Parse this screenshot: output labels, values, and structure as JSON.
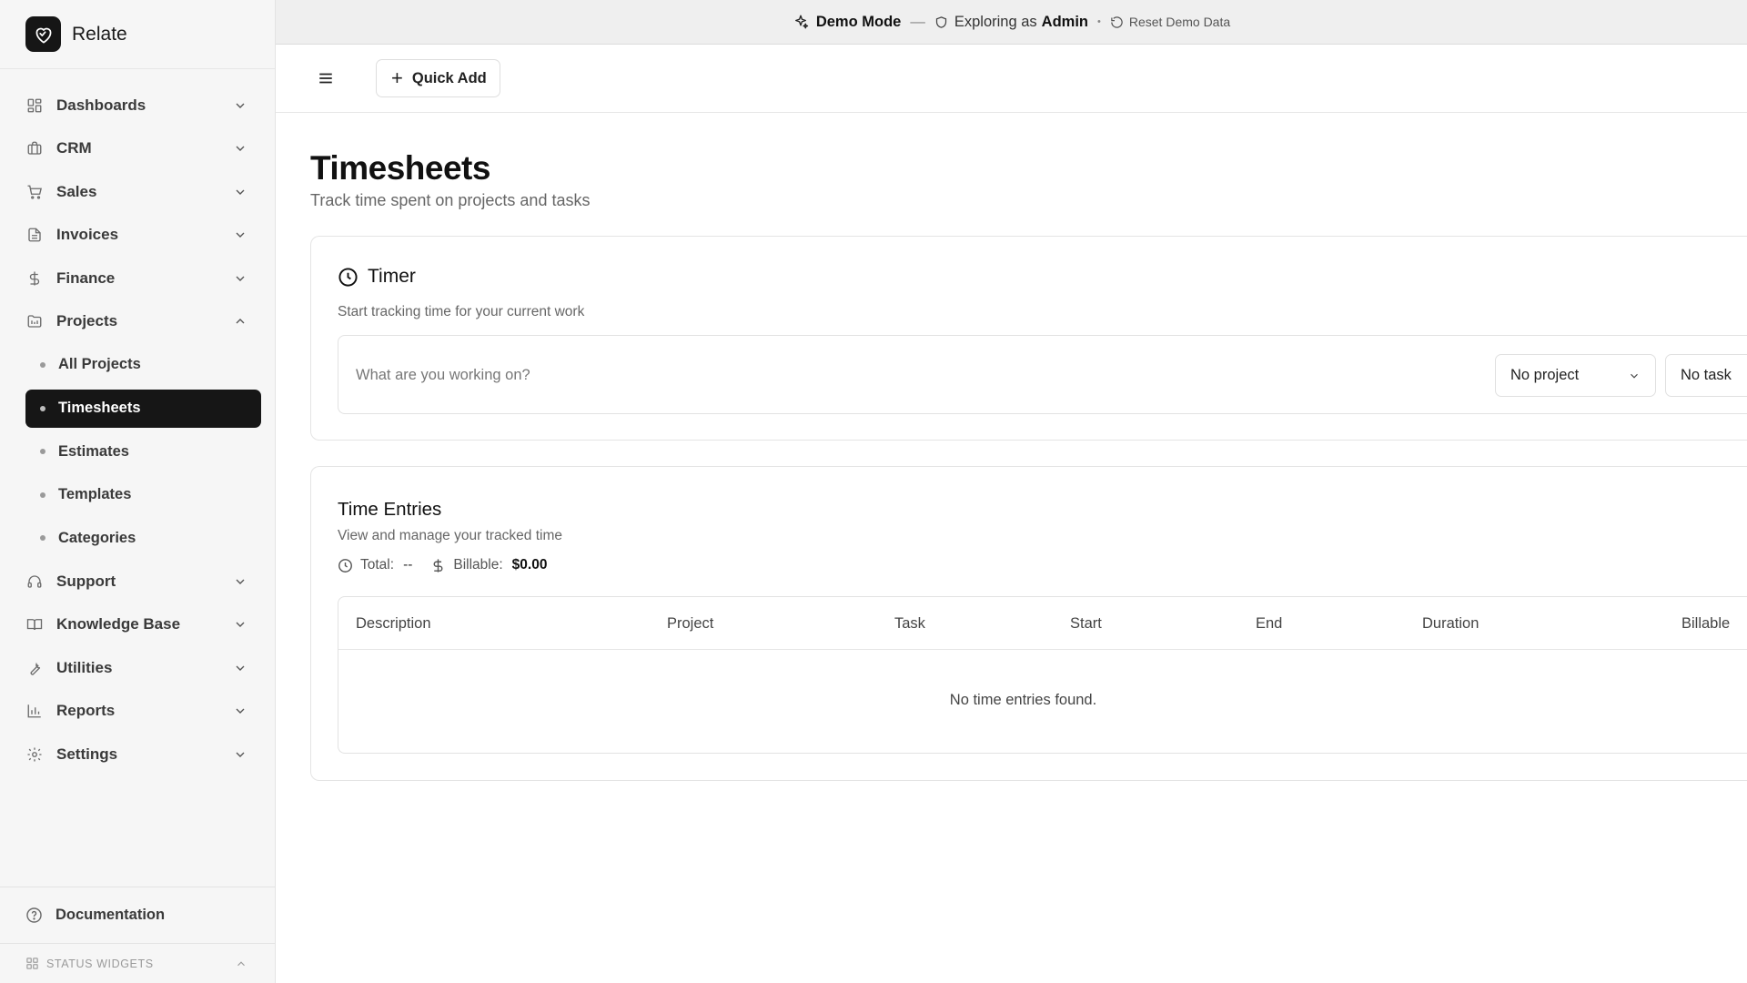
{
  "brand": {
    "name": "Relate"
  },
  "demo_bar": {
    "mode_label": "Demo Mode",
    "dash": "—",
    "exploring_prefix": "Exploring as",
    "role": "Admin",
    "dot": "•",
    "reset_label": "Reset Demo Data"
  },
  "toolbar": {
    "quick_add_label": "Quick Add"
  },
  "sidebar": {
    "items": [
      {
        "label": "Dashboards",
        "icon": "dashboard-icon"
      },
      {
        "label": "CRM",
        "icon": "briefcase-icon"
      },
      {
        "label": "Sales",
        "icon": "cart-icon"
      },
      {
        "label": "Invoices",
        "icon": "document-icon"
      },
      {
        "label": "Finance",
        "icon": "dollar-icon"
      },
      {
        "label": "Projects",
        "icon": "folder-icon",
        "expanded": true
      }
    ],
    "project_sub": [
      {
        "label": "All Projects"
      },
      {
        "label": "Timesheets",
        "active": true
      },
      {
        "label": "Estimates"
      },
      {
        "label": "Templates"
      },
      {
        "label": "Categories"
      }
    ],
    "items_after": [
      {
        "label": "Support",
        "icon": "headset-icon"
      },
      {
        "label": "Knowledge Base",
        "icon": "book-icon"
      },
      {
        "label": "Utilities",
        "icon": "wrench-icon"
      },
      {
        "label": "Reports",
        "icon": "bar-chart-icon"
      },
      {
        "label": "Settings",
        "icon": "gear-icon"
      }
    ],
    "documentation_label": "Documentation",
    "status_widgets_label": "STATUS WIDGETS"
  },
  "page": {
    "title": "Timesheets",
    "subtitle": "Track time spent on projects and tasks"
  },
  "timer": {
    "title": "Timer",
    "description": "Start tracking time for your current work",
    "placeholder": "What are you working on?",
    "project_select": "No project",
    "task_select": "No task"
  },
  "entries": {
    "title": "Time Entries",
    "description": "View and manage your tracked time",
    "total_label": "Total:",
    "total_value": "--",
    "billable_label": "Billable:",
    "billable_value": "$0.00",
    "columns": [
      "Description",
      "Project",
      "Task",
      "Start",
      "End",
      "Duration",
      "Billable"
    ],
    "empty_message": "No time entries found."
  },
  "colors": {
    "sidebar_bg": "#f6f6f6",
    "active_item_bg": "#161616",
    "demo_bar_bg": "#efefef"
  }
}
